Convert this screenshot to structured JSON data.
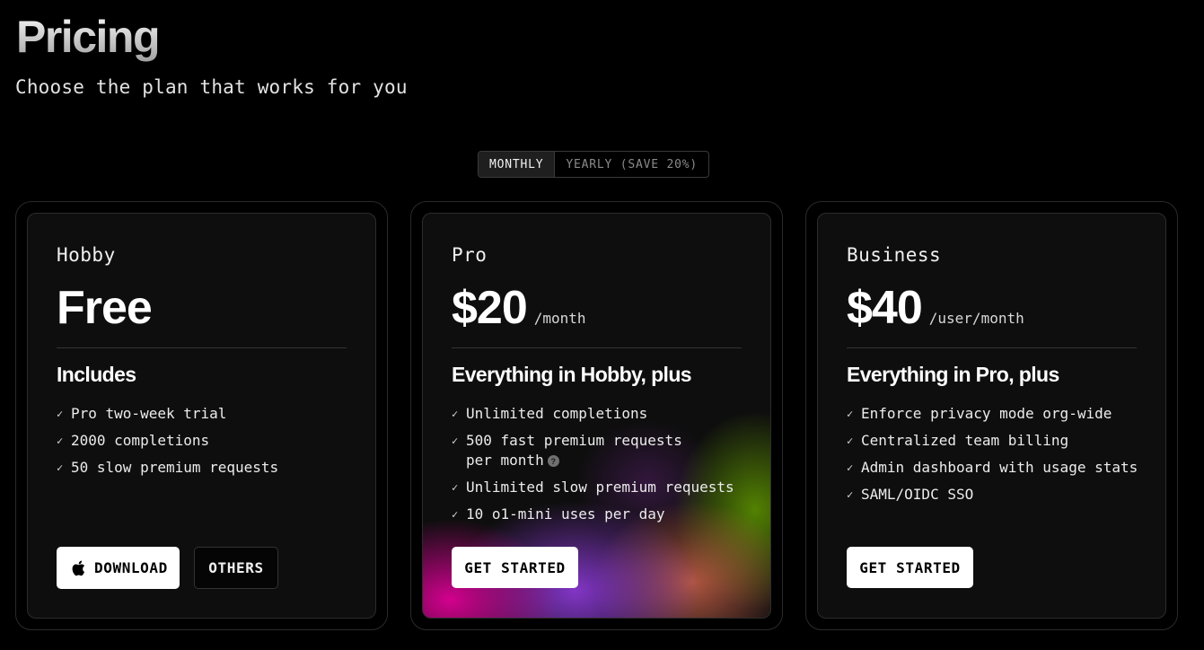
{
  "header": {
    "title": "Pricing",
    "subtitle": "Choose the plan that works for you"
  },
  "billing_toggle": {
    "monthly_label": "MONTHLY",
    "yearly_label": "YEARLY (SAVE 20%)",
    "selected": "monthly"
  },
  "plans": [
    {
      "name": "Hobby",
      "price": "Free",
      "unit": "",
      "includes_heading": "Includes",
      "features": [
        "Pro two-week trial",
        "2000 completions",
        "50 slow premium requests"
      ],
      "buttons": [
        {
          "label": "DOWNLOAD",
          "icon": "apple-icon",
          "style": "light"
        },
        {
          "label": "OTHERS",
          "style": "dark"
        }
      ]
    },
    {
      "name": "Pro",
      "price": "$20",
      "unit": "/month",
      "includes_heading": "Everything in Hobby, plus",
      "features": [
        "Unlimited completions",
        "500 fast premium requests per month",
        "Unlimited slow premium requests",
        "10 o1-mini uses per day"
      ],
      "info_icon_text": "?",
      "buttons": [
        {
          "label": "GET STARTED",
          "style": "light"
        }
      ]
    },
    {
      "name": "Business",
      "price": "$40",
      "unit": "/user/month",
      "includes_heading": "Everything in Pro, plus",
      "features": [
        "Enforce privacy mode org-wide",
        "Centralized team billing",
        "Admin dashboard with usage stats",
        "SAML/OIDC SSO"
      ],
      "buttons": [
        {
          "label": "GET STARTED",
          "style": "light"
        }
      ]
    }
  ],
  "check_glyph": "✓",
  "colors": {
    "background": "#000000",
    "card": "#0e0e0e",
    "button_light": "#ffffff",
    "pro_gradient": [
      "#de0096",
      "#963ce6",
      "#e66e50",
      "#5f9600"
    ]
  }
}
